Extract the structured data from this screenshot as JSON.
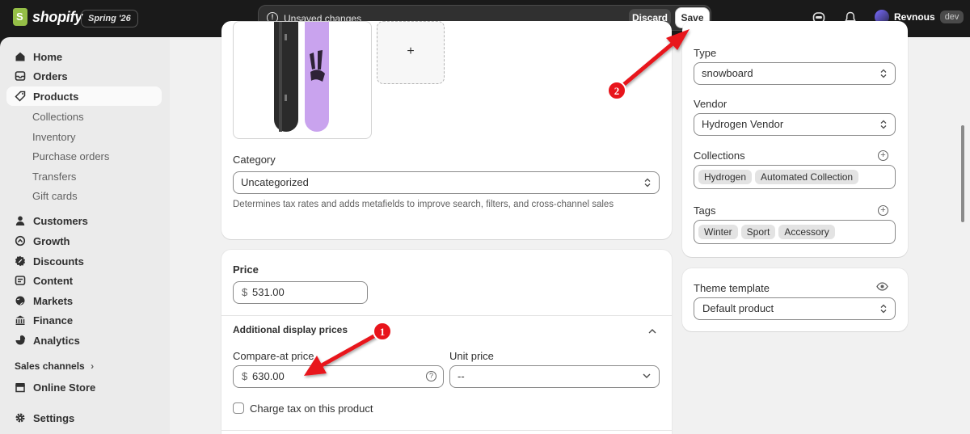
{
  "topbar": {
    "logo_text": "shopify",
    "season_badge": "Spring '26",
    "unsaved_message": "Unsaved changes",
    "discard_label": "Discard",
    "save_label": "Save",
    "user_name": "Revnous",
    "user_badge": "dev"
  },
  "sidebar": {
    "items": [
      {
        "label": "Home",
        "icon": "home-icon"
      },
      {
        "label": "Orders",
        "icon": "orders-icon"
      },
      {
        "label": "Products",
        "icon": "tag-icon",
        "active": true
      },
      {
        "label": "Customers",
        "icon": "person-icon"
      },
      {
        "label": "Growth",
        "icon": "growth-icon"
      },
      {
        "label": "Discounts",
        "icon": "discount-icon"
      },
      {
        "label": "Content",
        "icon": "content-icon"
      },
      {
        "label": "Markets",
        "icon": "globe-icon"
      },
      {
        "label": "Finance",
        "icon": "bank-icon"
      },
      {
        "label": "Analytics",
        "icon": "analytics-icon"
      }
    ],
    "product_subitems": [
      "Collections",
      "Inventory",
      "Purchase orders",
      "Transfers",
      "Gift cards"
    ],
    "sales_channels_label": "Sales channels",
    "online_store_label": "Online Store",
    "settings_label": "Settings"
  },
  "media": {
    "add_label": "+"
  },
  "category": {
    "label": "Category",
    "value": "Uncategorized",
    "help": "Determines tax rates and adds metafields to improve search, filters, and cross-channel sales"
  },
  "price": {
    "title": "Price",
    "currency": "$",
    "value": "531.00",
    "additional_title": "Additional display prices",
    "compare_label": "Compare-at price",
    "compare_value": "630.00",
    "unit_label": "Unit price",
    "unit_value": "--",
    "charge_tax_label": "Charge tax on this product"
  },
  "organization": {
    "type_label": "Type",
    "type_value": "snowboard",
    "vendor_label": "Vendor",
    "vendor_value": "Hydrogen Vendor",
    "collections_label": "Collections",
    "collections": [
      "Hydrogen",
      "Automated Collection"
    ],
    "tags_label": "Tags",
    "tags": [
      "Winter",
      "Sport",
      "Accessory"
    ]
  },
  "theme": {
    "label": "Theme template",
    "value": "Default product"
  },
  "annotations": {
    "marker_1": "1",
    "marker_2": "2"
  },
  "colors": {
    "arrow_red": "#e8141b",
    "board_purple": "#c9a3ee",
    "topbar_bg": "#1a1a1a",
    "sidebar_bg": "#ebebeb"
  }
}
